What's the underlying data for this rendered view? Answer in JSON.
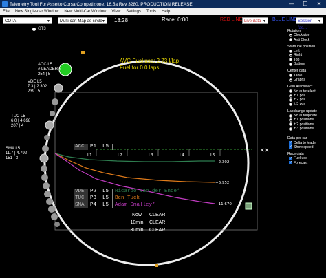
{
  "window": {
    "title": "Telemetry Tool For Assetto Corsa Competizione, 16.5a Rev 3280, PRODUCTION RELEASE",
    "buttons": [
      "—",
      "☐",
      "✕"
    ]
  },
  "menu": [
    "File",
    "New Single-car Window",
    "New Multi-Car Window",
    "View",
    "Settings",
    "Tools",
    "Help"
  ],
  "toolbar": {
    "track": "COTA",
    "mode": "Multi-car: Map as circle",
    "session_time": "18:28",
    "race_time": "Race: 0:00",
    "red_team": "RED LINE",
    "live_data": "Live data",
    "blue_team": "BLUE LINE",
    "session": "Session fas..."
  },
  "filter": {
    "gt3_label": "GT3"
  },
  "fuel": {
    "avg": "AVG Fuel use: 2.73 l/lap",
    "for_laps": "Fuel for 0.0 laps"
  },
  "cars": [
    {
      "tag": "ACC L5\n# LEADER #\n254 | 5"
    },
    {
      "tag": "VDE L5\n7.3 | 2.302\n239 | 5"
    },
    {
      "tag": "TUC L5\n6.0 | 4.698\n207 | 4"
    },
    {
      "tag": "SMA L5\n11.7 | 4.792\n151 | 3"
    }
  ],
  "gap_chart": {
    "leader": {
      "code": "ACC",
      "pos": "P1",
      "lap": "L5"
    },
    "lap_ticks": [
      "L1",
      "L2",
      "L3",
      "L4",
      "L5"
    ],
    "drivers": [
      {
        "code": "VDE",
        "pos": "P2",
        "lap": "L5",
        "name": "Ricardo van der Ende*",
        "gap": "+2.302",
        "color": "#2e7d4f"
      },
      {
        "code": "TUC",
        "pos": "P3",
        "lap": "L5",
        "name": "Ben Tuck",
        "gap": "+6.952",
        "color": "#e07b1a"
      },
      {
        "code": "SMA",
        "pos": "P4",
        "lap": "L5",
        "name": "Adam Smalley*",
        "gap": "+11.670",
        "color": "#c23cc2"
      }
    ]
  },
  "laps_table": [
    {
      "label": "Now",
      "value": "CLEAR"
    },
    {
      "label": "10min",
      "value": "CLEAR"
    },
    {
      "label": "30min",
      "value": "CLEAR"
    }
  ],
  "panel": {
    "rotation": {
      "title": "Rotation",
      "options": [
        {
          "label": "Clockwise",
          "on": true
        },
        {
          "label": "Anti Clock",
          "on": false
        }
      ]
    },
    "start_line": {
      "title": "StartLine position",
      "options": [
        {
          "label": "Left",
          "on": false
        },
        {
          "label": "Right",
          "on": true
        },
        {
          "label": "Top",
          "on": false
        },
        {
          "label": "Bottom",
          "on": false
        }
      ]
    },
    "center_data": {
      "title": "Center data",
      "options": [
        {
          "label": "Table",
          "on": false
        },
        {
          "label": "Graphs",
          "on": true
        }
      ]
    },
    "gain": {
      "title": "Gain Autoselect",
      "options": [
        {
          "label": "No autoselect",
          "on": false
        },
        {
          "label": "± 1 pos",
          "on": true
        },
        {
          "label": "± 2 pos",
          "on": false
        },
        {
          "label": "± 3 pos",
          "on": false
        }
      ]
    },
    "lapchange": {
      "title": "Lapchange update",
      "options": [
        {
          "label": "No autoupdate",
          "on": false
        },
        {
          "label": "± 1 positions",
          "on": true
        },
        {
          "label": "± 2 positions",
          "on": false
        },
        {
          "label": "± 3 positions",
          "on": false
        }
      ]
    },
    "data_per_car": {
      "title": "Data per car",
      "options": [
        {
          "label": "Delta to leader",
          "on": true
        },
        {
          "label": "Show speed",
          "on": true
        }
      ]
    },
    "race_data": {
      "title": "Race data",
      "options": [
        {
          "label": "Fuel use",
          "on": true
        },
        {
          "label": "Forecast",
          "on": true
        }
      ]
    }
  },
  "colors": {
    "accent_green": "#22cc22",
    "fuel_text": "#e8d800",
    "red_team": "#dd1111",
    "blue_team": "#3a5bff"
  }
}
